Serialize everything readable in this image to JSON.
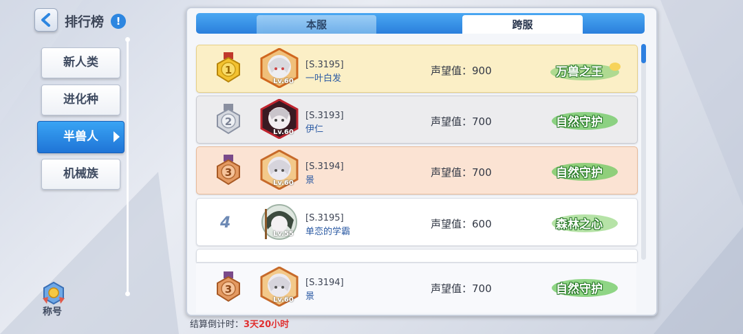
{
  "header": {
    "title": "排行榜",
    "info_glyph": "!"
  },
  "categories": [
    {
      "label": "新人类",
      "active": false
    },
    {
      "label": "进化种",
      "active": false
    },
    {
      "label": "半兽人",
      "active": true
    },
    {
      "label": "机械族",
      "active": false
    }
  ],
  "title_button": {
    "label": "称号",
    "icon": "title-badge-icon"
  },
  "tabs": {
    "local": "本服",
    "cross": "跨服",
    "selected": "cross"
  },
  "rows": [
    {
      "rank": "1",
      "server": "[S.3195]",
      "name": "一叶白发",
      "level": "Lv.60",
      "prestige": "声望值：900",
      "badge": "万兽之王"
    },
    {
      "rank": "2",
      "server": "[S.3193]",
      "name": "伊仁",
      "level": "Lv.60",
      "prestige": "声望值：700",
      "badge": "自然守护"
    },
    {
      "rank": "3",
      "server": "[S.3194]",
      "name": "景",
      "level": "Lv.60",
      "prestige": "声望值：700",
      "badge": "自然守护"
    },
    {
      "rank": "4",
      "server": "[S.3195]",
      "name": "单恋的学霸",
      "level": "Lv.55",
      "prestige": "声望值：600",
      "badge": "森林之心"
    }
  ],
  "self_row": {
    "rank": "3",
    "server": "[S.3194]",
    "name": "景",
    "level": "Lv.60",
    "prestige": "声望值：700",
    "badge": "自然守护"
  },
  "footer": {
    "label": "结算倒计时：",
    "countdown": "3天20小时"
  },
  "colors": {
    "accent": "#2a7fdc",
    "gold_row": "#fbefc6",
    "silver_row": "#ececee",
    "bronze_row": "#fbe3d3",
    "badge_green": "#5fc25a",
    "countdown": "#e03030"
  }
}
